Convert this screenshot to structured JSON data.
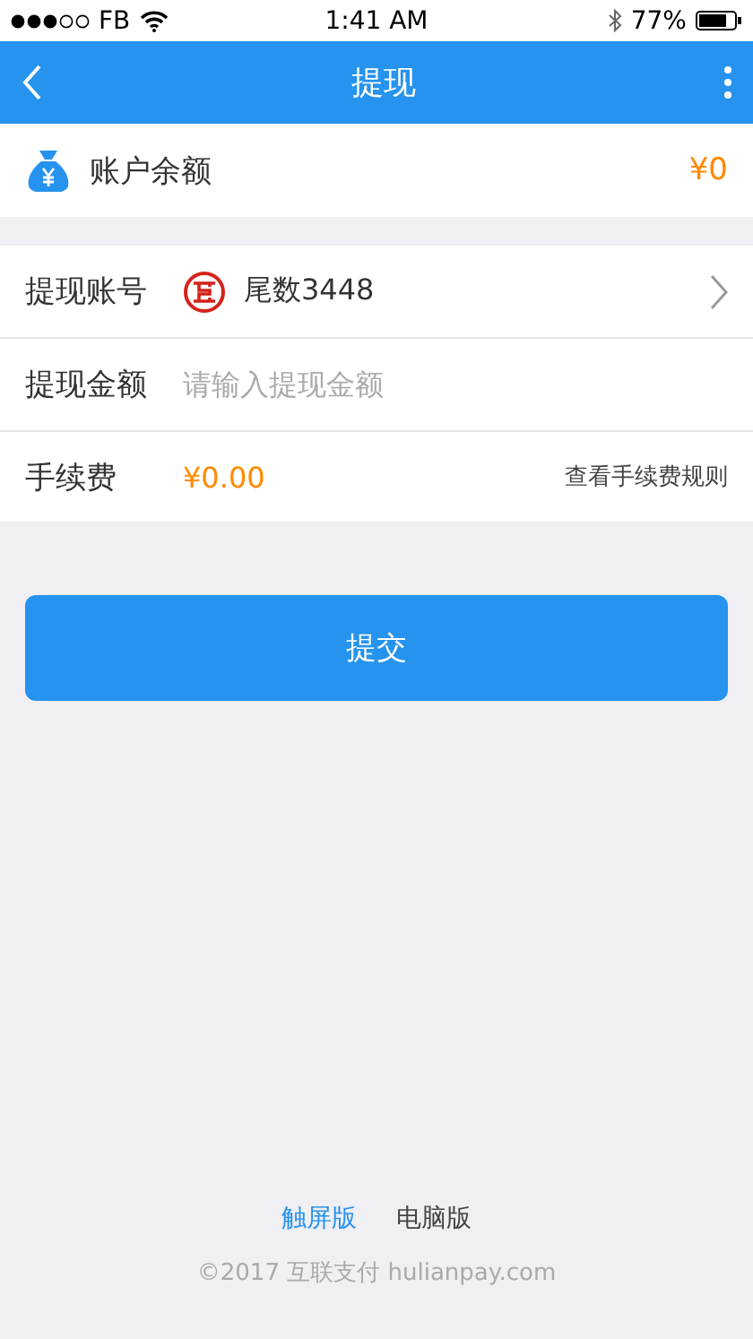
{
  "status_bar": {
    "carrier": "FB",
    "time": "1:41 AM",
    "battery": "77%"
  },
  "nav": {
    "title": "提现"
  },
  "balance": {
    "label": "账户余额",
    "amount": "¥0"
  },
  "form": {
    "account": {
      "label": "提现账号",
      "value": "尾数3448"
    },
    "amount": {
      "label": "提现金额",
      "placeholder": "请输入提现金额"
    },
    "fee": {
      "label": "手续费",
      "value": "¥0.00",
      "link": "查看手续费规则"
    }
  },
  "submit": "提交",
  "footer": {
    "versions": [
      {
        "label": "触屏版",
        "selected": true
      },
      {
        "label": "电脑版",
        "selected": false
      }
    ],
    "copyright": "©2017 互联支付 hulianpay.com"
  }
}
